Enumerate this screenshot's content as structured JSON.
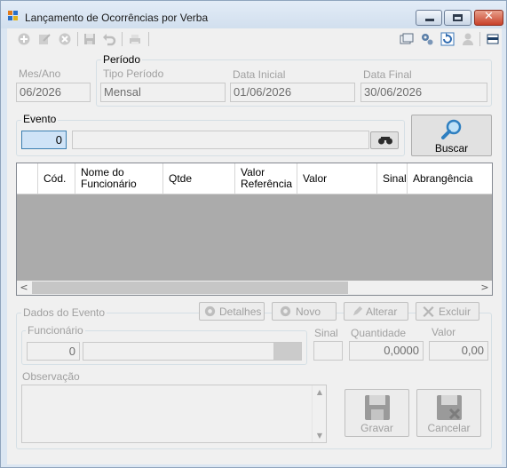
{
  "window": {
    "title": "Lançamento de Ocorrências por Verba",
    "close_symbol": "✕"
  },
  "toolbar": {
    "left_icons": [
      "add-icon",
      "edit-icon",
      "delete-icon",
      "save-icon",
      "undo-icon",
      "print-icon"
    ],
    "right_icons": [
      "window-icon",
      "settings-icon",
      "refresh-icon",
      "user-icon",
      "panel-icon"
    ]
  },
  "filters": {
    "mes_ano_label": "Mes/Ano",
    "mes_ano_value": "06/2026",
    "periodo_title": "Período",
    "tipo_periodo_label": "Tipo Período",
    "tipo_periodo_value": "Mensal",
    "data_inicial_label": "Data Inicial",
    "data_inicial_value": "01/06/2026",
    "data_final_label": "Data Final",
    "data_final_value": "30/06/2026"
  },
  "evento": {
    "title": "Evento",
    "code_value": "0",
    "name_value": "",
    "buscar_label": "Buscar"
  },
  "grid": {
    "columns": [
      "",
      "Cód.",
      "Nome do Funcionário",
      "Qtde",
      "Valor Referência",
      "Valor",
      "Sinal",
      "Abrangência"
    ],
    "rows": [],
    "scroll_left": "<",
    "scroll_right": ">"
  },
  "dados_evento": {
    "title": "Dados do Evento",
    "detalhes_label": "Detalhes",
    "novo_label": "Novo",
    "alterar_label": "Alterar",
    "excluir_label": "Excluir",
    "funcionario_title": "Funcionário",
    "funcionario_code": "0",
    "funcionario_name": "",
    "sinal_label": "Sinal",
    "sinal_value": "",
    "quantidade_label": "Quantidade",
    "quantidade_value": "0,0000",
    "valor_label": "Valor",
    "valor_value": "0,00",
    "observacao_label": "Observação",
    "observacao_value": "",
    "gravar_label": "Gravar",
    "cancelar_label": "Cancelar"
  },
  "colors": {
    "title_bar": "#dbe6f2",
    "grid_empty": "#ababab",
    "close_button": "#c8412a",
    "focus_field": "#cfe3f7"
  }
}
